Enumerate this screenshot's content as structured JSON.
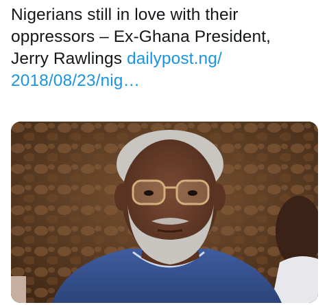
{
  "tweet": {
    "text_line1": "Nigerians still in love with their",
    "text_line2": "oppressors – Ex-Ghana President,",
    "text_line3": "Jerry Rawlings",
    "link_part1": "dailypost.ng/",
    "link_part2": "2018/08/23/nig…"
  },
  "colors": {
    "text": "#14171a",
    "link": "#1b95e0"
  },
  "media": {
    "icon": "photo-of-man-icon"
  }
}
